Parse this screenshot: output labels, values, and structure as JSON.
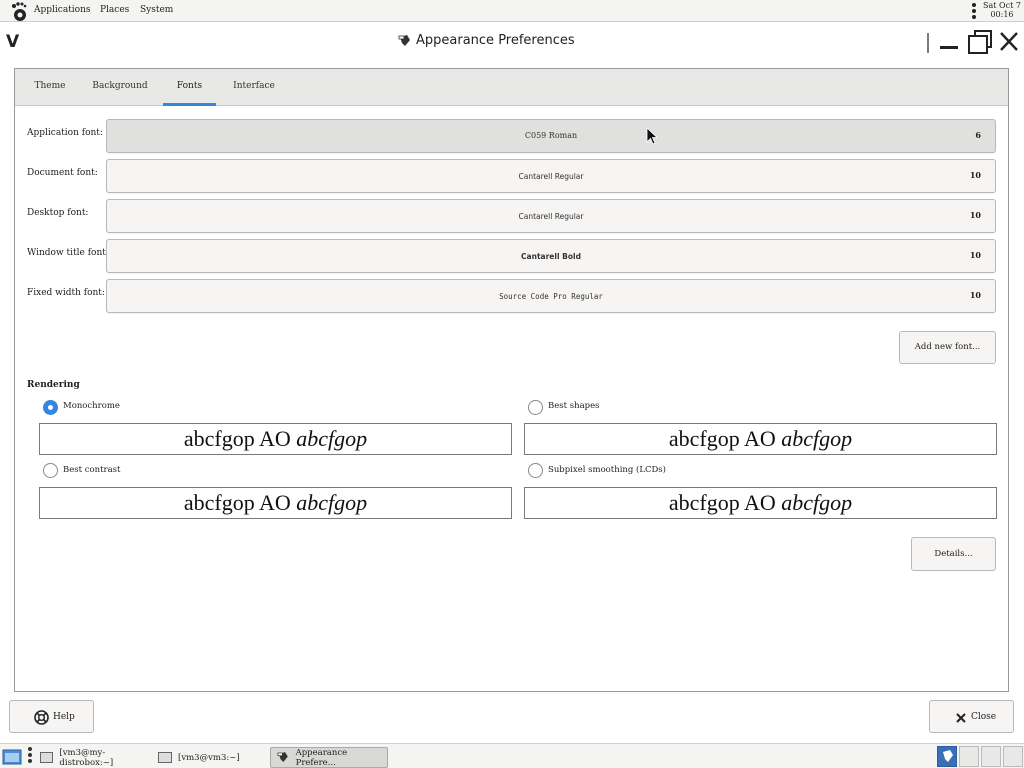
{
  "top_panel": {
    "menus": [
      "Applications",
      "Places",
      "System"
    ],
    "clock_date": "Sat Oct 7",
    "clock_time": "00:16"
  },
  "window": {
    "title": "Appearance Preferences"
  },
  "tabs": [
    {
      "label": "Theme",
      "active": false
    },
    {
      "label": "Background",
      "active": false
    },
    {
      "label": "Fonts",
      "active": true
    },
    {
      "label": "Interface",
      "active": false
    }
  ],
  "fonts": [
    {
      "label": "Application font:",
      "name": "C059 Roman",
      "size": "6"
    },
    {
      "label": "Document font:",
      "name": "Cantarell Regular",
      "size": "10"
    },
    {
      "label": "Desktop font:",
      "name": "Cantarell Regular",
      "size": "10"
    },
    {
      "label": "Window title font:",
      "name": "Cantarell Bold",
      "size": "10"
    },
    {
      "label": "Fixed width font:",
      "name": "Source Code Pro Regular",
      "size": "10"
    }
  ],
  "add_font_button": "Add new font...",
  "rendering": {
    "title": "Rendering",
    "options": [
      {
        "label": "Monochrome",
        "checked": true,
        "sample_upright": "abcfgop AO",
        "sample_italic": "abcfgop"
      },
      {
        "label": "Best shapes",
        "checked": false,
        "sample_upright": "abcfgop AO",
        "sample_italic": "abcfgop"
      },
      {
        "label": "Best contrast",
        "checked": false,
        "sample_upright": "abcfgop AO",
        "sample_italic": "abcfgop"
      },
      {
        "label": "Subpixel smoothing (LCDs)",
        "checked": false,
        "sample_upright": "abcfgop AO",
        "sample_italic": "abcfgop"
      }
    ]
  },
  "details_button": "Details...",
  "help_button": "Help",
  "close_button": "Close",
  "taskbar": {
    "tasks": [
      {
        "label": "[vm3@my-distrobox:~]",
        "active": false
      },
      {
        "label": "[vm3@vm3:~]",
        "active": false
      },
      {
        "label": "Appearance Prefere...",
        "active": true
      }
    ]
  },
  "colors": {
    "accent": "#3584e4",
    "tab_bar": "#e8e8e6",
    "panel": "#f4f4f2"
  }
}
